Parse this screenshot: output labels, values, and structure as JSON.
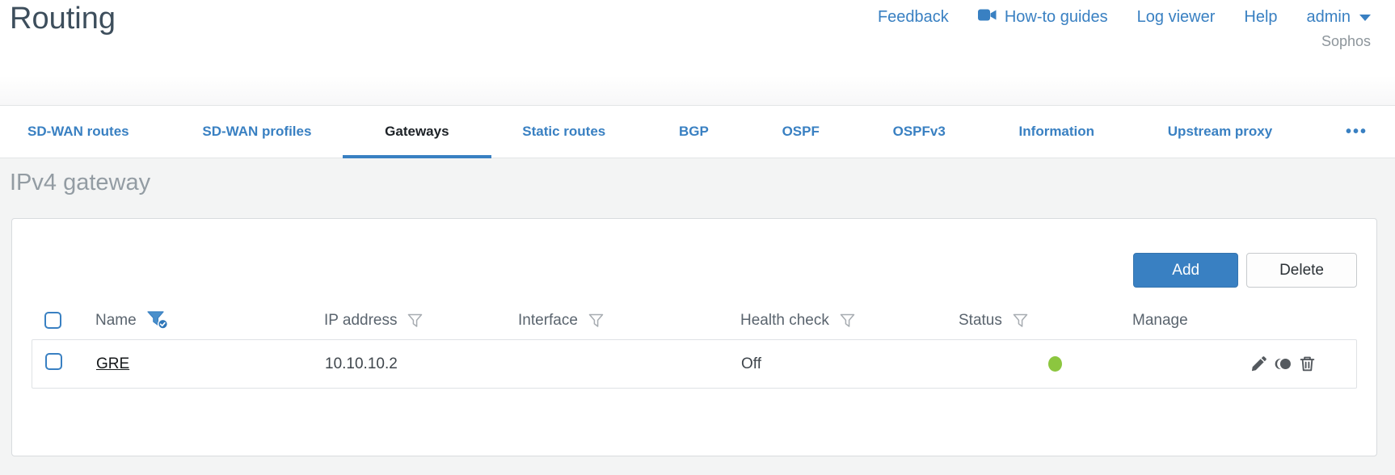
{
  "header": {
    "title": "Routing",
    "links": [
      "Feedback",
      "How-to guides",
      "Log viewer",
      "Help"
    ],
    "user": "admin",
    "brand": "Sophos"
  },
  "tabs": [
    {
      "label": "SD-WAN routes",
      "active": false
    },
    {
      "label": "SD-WAN profiles",
      "active": false
    },
    {
      "label": "Gateways",
      "active": true
    },
    {
      "label": "Static routes",
      "active": false
    },
    {
      "label": "BGP",
      "active": false
    },
    {
      "label": "OSPF",
      "active": false
    },
    {
      "label": "OSPFv3",
      "active": false
    },
    {
      "label": "Information",
      "active": false
    },
    {
      "label": "Upstream proxy",
      "active": false
    }
  ],
  "tabs_more": {
    "label": "•••"
  },
  "section": {
    "heading": "IPv4 gateway",
    "buttons": {
      "add": "Add",
      "delete": "Delete"
    },
    "table": {
      "columns": [
        {
          "label": "",
          "filter": null
        },
        {
          "label": "Name",
          "filter": "active"
        },
        {
          "label": "IP address",
          "filter": "default"
        },
        {
          "label": "Interface",
          "filter": "default"
        },
        {
          "label": "Health check",
          "filter": "default"
        },
        {
          "label": "Status",
          "filter": "default"
        },
        {
          "label": "Manage",
          "filter": null
        }
      ],
      "rows": [
        {
          "name": "GRE",
          "ip_address": "10.10.10.2",
          "interface": "",
          "health_check": "Off",
          "status": "green"
        }
      ]
    }
  },
  "icons": {
    "howto": "video-camera-icon",
    "admin": "chevron-down-icon",
    "name_filter": "funnel-filter-active-icon",
    "column_filter": "funnel-filter-icon",
    "manage": [
      "edit-pencil-icon",
      "clone-icon",
      "trash-icon"
    ],
    "more_tab": "ellipsis-icon"
  },
  "colors": {
    "accent_blue": "#3980c2",
    "status_green": "#8cc63f",
    "title_gray": "#3d4e5c",
    "heading_gray": "#939ca3"
  }
}
